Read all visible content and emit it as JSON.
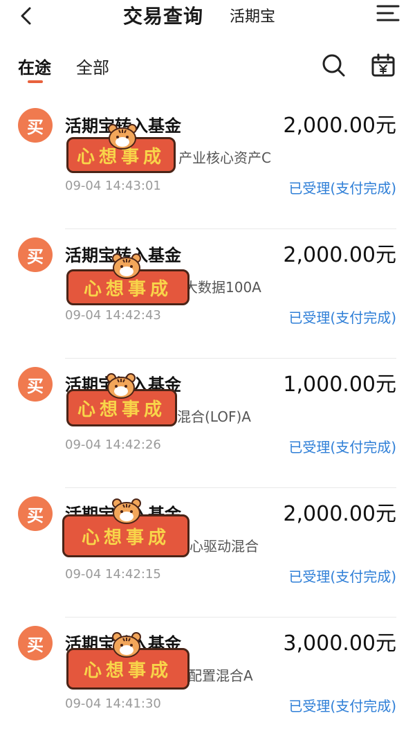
{
  "header": {
    "title": "交易查询",
    "subtitle": "活期宝"
  },
  "tabs": [
    {
      "label": "在途"
    },
    {
      "label": "全部"
    }
  ],
  "icons": {
    "back": "chevron-left-icon",
    "menu": "menu-icon",
    "search": "search-icon",
    "calendar": "calendar-yen-icon"
  },
  "colors": {
    "accent": "#e8623d",
    "avatar": "#f07a4f",
    "status": "#2f7fd7"
  },
  "sticker_text": "心想事成",
  "transactions": [
    {
      "badge": "买",
      "name": "活期宝转入基金",
      "amount": "2,000.00元",
      "fund_partial": "产业核心资产C",
      "time": "09-04 14:43:01",
      "status": "已受理(支付完成)"
    },
    {
      "badge": "买",
      "name": "活期宝转入基金",
      "amount": "2,000.00元",
      "fund_partial": "大数据100A",
      "time": "09-04 14:42:43",
      "status": "已受理(支付完成)"
    },
    {
      "badge": "买",
      "name": "活期宝转入基金",
      "amount": "1,000.00元",
      "fund_partial": "混合(LOF)A",
      "time": "09-04 14:42:26",
      "status": "已受理(支付完成)"
    },
    {
      "badge": "买",
      "name": "活期宝转入基金",
      "amount": "2,000.00元",
      "fund_partial": "心驱动混合",
      "time": "09-04 14:42:15",
      "status": "已受理(支付完成)"
    },
    {
      "badge": "买",
      "name": "活期宝转入基金",
      "amount": "3,000.00元",
      "fund_partial": "配置混合A",
      "time": "09-04 14:41:30",
      "status": "已受理(支付完成)"
    }
  ]
}
